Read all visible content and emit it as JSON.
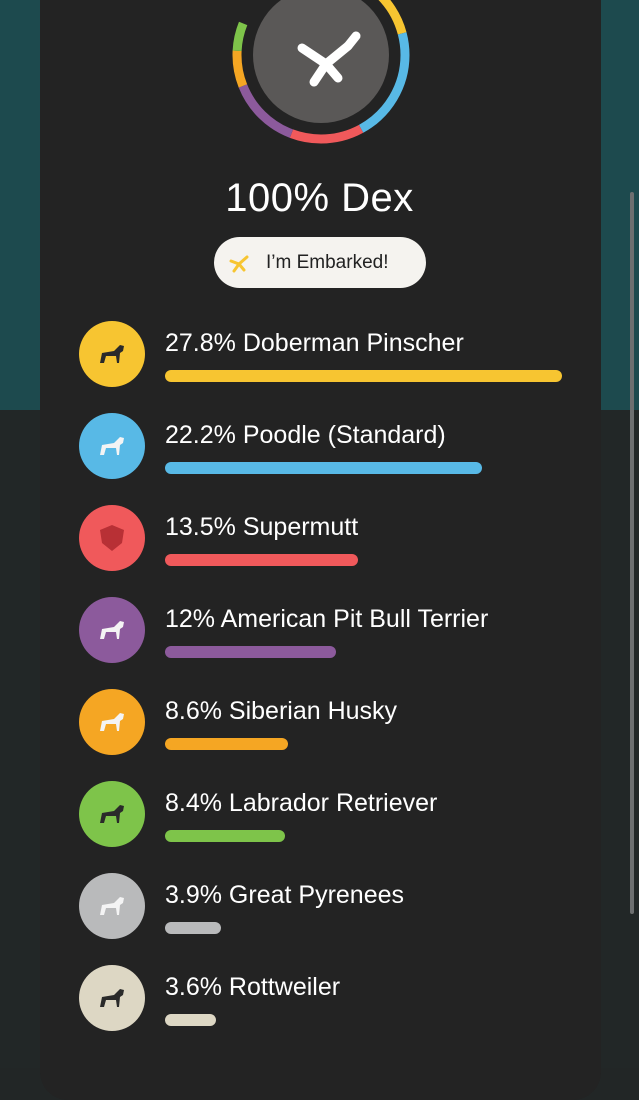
{
  "summary": {
    "title": "100% Dex",
    "badge_label": "I’m Embarked!",
    "ring_icon": "embark-logo-icon",
    "ring_colors": [
      "#f7c531",
      "#58b9e6",
      "#f0595b",
      "#8c5a9c",
      "#f5a623",
      "#7ec44a"
    ]
  },
  "breeds": [
    {
      "label": "27.8% Doberman Pinscher",
      "percent": 27.8,
      "color": "#f7c531",
      "icon": "doberman-pinscher-icon"
    },
    {
      "label": "22.2% Poodle (Standard)",
      "percent": 22.2,
      "color": "#58b9e6",
      "icon": "poodle-icon"
    },
    {
      "label": "13.5% Supermutt",
      "percent": 13.5,
      "color": "#f0595b",
      "icon": "supermutt-shield-icon"
    },
    {
      "label": "12% American Pit Bull Terrier",
      "percent": 12,
      "color": "#8c5a9c",
      "icon": "pit-bull-terrier-icon"
    },
    {
      "label": "8.6% Siberian Husky",
      "percent": 8.6,
      "color": "#f5a623",
      "icon": "siberian-husky-icon"
    },
    {
      "label": "8.4% Labrador Retriever",
      "percent": 8.4,
      "color": "#7ec44a",
      "icon": "labrador-retriever-icon"
    },
    {
      "label": "3.9% Great Pyrenees",
      "percent": 3.9,
      "color": "#b9babb",
      "icon": "great-pyrenees-icon"
    },
    {
      "label": "3.6% Rottweiler",
      "percent": 3.6,
      "color": "#ddd7c4",
      "icon": "rottweiler-icon"
    }
  ]
}
